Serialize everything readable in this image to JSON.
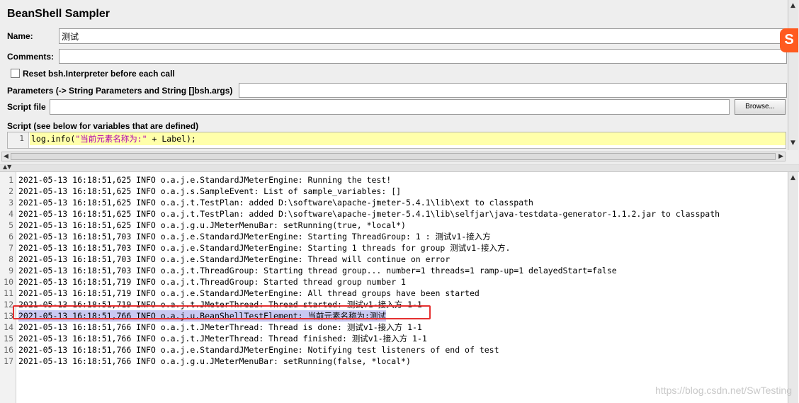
{
  "panel": {
    "title": "BeanShell Sampler",
    "name_label": "Name:",
    "name_value": "测试",
    "comments_label": "Comments:",
    "comments_value": "",
    "reset_label": "Reset bsh.Interpreter before each call",
    "reset_checked": false,
    "parameters_label": "Parameters (-> String Parameters and String []bsh.args)",
    "parameters_value": "",
    "script_file_label": "Script file",
    "script_file_value": "",
    "browse_label": "Browse...",
    "script_label": "Script (see below for variables that are defined)",
    "script_lines": [
      {
        "num": "1",
        "code_prefix": "log.info(",
        "code_string": "\"当前元素名称为:\"",
        "code_suffix": " + Label);"
      }
    ]
  },
  "log": {
    "selected_line": 13,
    "lines": [
      {
        "num": "1",
        "text": "2021-05-13 16:18:51,625 INFO o.a.j.e.StandardJMeterEngine: Running the test!"
      },
      {
        "num": "2",
        "text": "2021-05-13 16:18:51,625 INFO o.a.j.s.SampleEvent: List of sample_variables: []"
      },
      {
        "num": "3",
        "text": "2021-05-13 16:18:51,625 INFO o.a.j.t.TestPlan: added D:\\software\\apache-jmeter-5.4.1\\lib\\ext to classpath"
      },
      {
        "num": "4",
        "text": "2021-05-13 16:18:51,625 INFO o.a.j.t.TestPlan: added D:\\software\\apache-jmeter-5.4.1\\lib\\selfjar\\java-testdata-generator-1.1.2.jar to classpath"
      },
      {
        "num": "5",
        "text": "2021-05-13 16:18:51,625 INFO o.a.j.g.u.JMeterMenuBar: setRunning(true, *local*)"
      },
      {
        "num": "6",
        "text": "2021-05-13 16:18:51,703 INFO o.a.j.e.StandardJMeterEngine: Starting ThreadGroup: 1 : 测试v1-接入方"
      },
      {
        "num": "7",
        "text": "2021-05-13 16:18:51,703 INFO o.a.j.e.StandardJMeterEngine: Starting 1 threads for group 测试v1-接入方."
      },
      {
        "num": "8",
        "text": "2021-05-13 16:18:51,703 INFO o.a.j.e.StandardJMeterEngine: Thread will continue on error"
      },
      {
        "num": "9",
        "text": "2021-05-13 16:18:51,703 INFO o.a.j.t.ThreadGroup: Starting thread group... number=1 threads=1 ramp-up=1 delayedStart=false"
      },
      {
        "num": "10",
        "text": "2021-05-13 16:18:51,719 INFO o.a.j.t.ThreadGroup: Started thread group number 1"
      },
      {
        "num": "11",
        "text": "2021-05-13 16:18:51,719 INFO o.a.j.e.StandardJMeterEngine: All thread groups have been started"
      },
      {
        "num": "12",
        "text": "2021-05-13 16:18:51,719 INFO o.a.j.t.JMeterThread: Thread started: 测试v1-接入方 1-1"
      },
      {
        "num": "13",
        "text": "2021-05-13 16:18:51,766 INFO o.a.j.u.BeanShellTestElement: 当前元素名称为:测试"
      },
      {
        "num": "14",
        "text": "2021-05-13 16:18:51,766 INFO o.a.j.t.JMeterThread: Thread is done: 测试v1-接入方 1-1"
      },
      {
        "num": "15",
        "text": "2021-05-13 16:18:51,766 INFO o.a.j.t.JMeterThread: Thread finished: 测试v1-接入方 1-1"
      },
      {
        "num": "16",
        "text": "2021-05-13 16:18:51,766 INFO o.a.j.e.StandardJMeterEngine: Notifying test listeners of end of test"
      },
      {
        "num": "17",
        "text": "2021-05-13 16:18:51,766 INFO o.a.j.g.u.JMeterMenuBar: setRunning(false, *local*)"
      }
    ]
  },
  "watermark": "https://blog.csdn.net/SwTesting",
  "sogou_icon_text": "S",
  "colors": {
    "highlight_border": "#e53030",
    "selected_row": "#c9c9f2",
    "script_line_bg": "#ffffaa",
    "string_color": "#b000b0"
  }
}
